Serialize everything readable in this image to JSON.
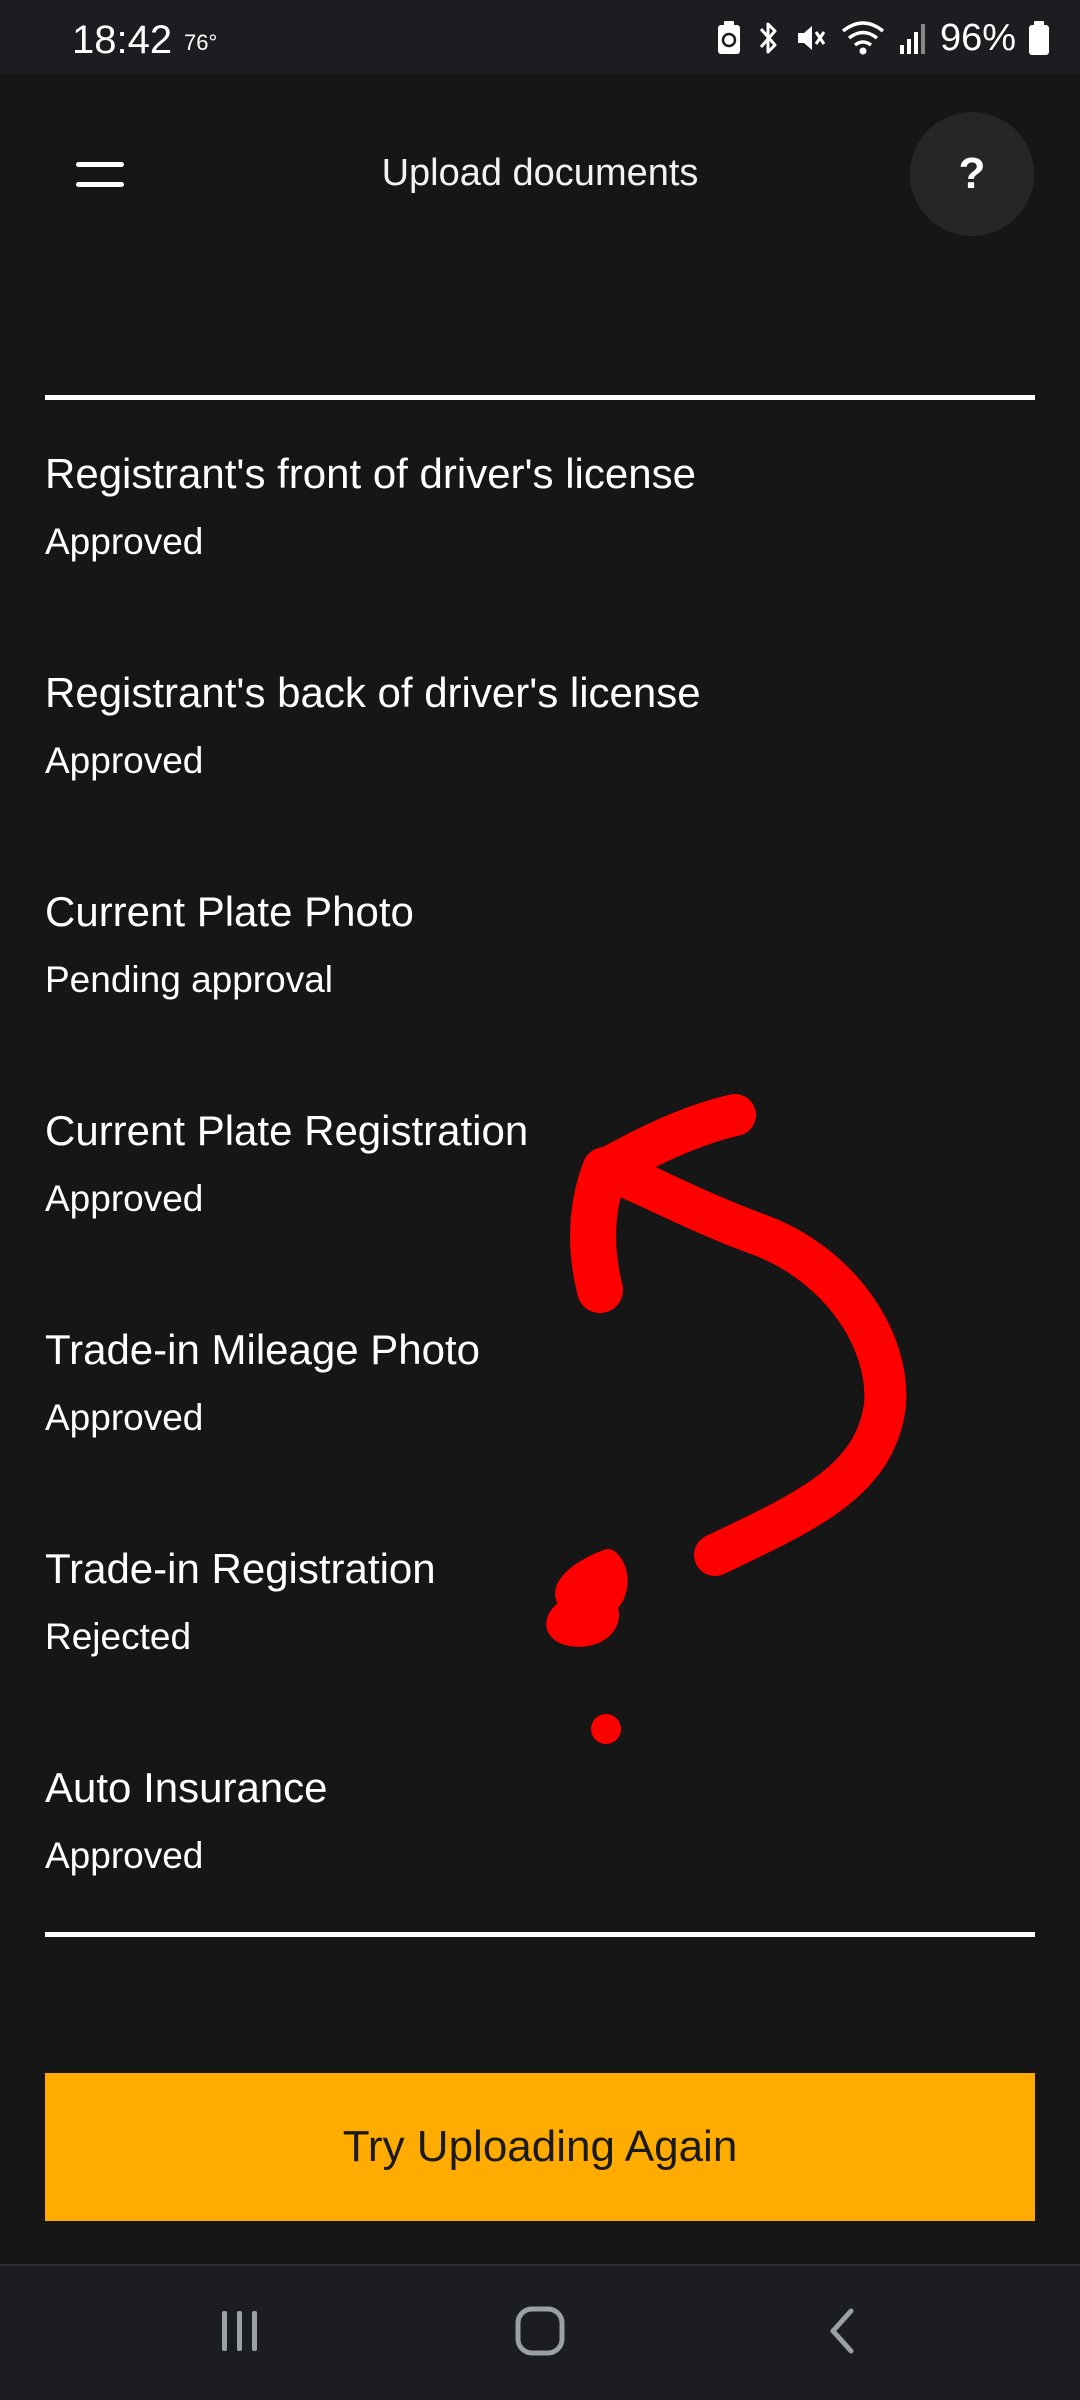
{
  "status_bar": {
    "time": "18:42",
    "temperature": "76°",
    "battery_percent": "96%",
    "icons": [
      "battery-saver-icon",
      "bluetooth-icon",
      "mute-icon",
      "wifi-icon",
      "signal-icon",
      "battery-icon"
    ]
  },
  "app_bar": {
    "title": "Upload documents",
    "menu_icon": "hamburger-menu-icon",
    "help_label": "?"
  },
  "documents": [
    {
      "title": "Registrant's front of driver's license",
      "status": "Approved"
    },
    {
      "title": "Registrant's back of driver's license",
      "status": "Approved"
    },
    {
      "title": "Current Plate Photo",
      "status": "Pending approval"
    },
    {
      "title": "Current Plate Registration",
      "status": "Approved"
    },
    {
      "title": "Trade-in Mileage Photo",
      "status": "Approved"
    },
    {
      "title": "Trade-in Registration",
      "status": "Rejected"
    },
    {
      "title": "Auto Insurance",
      "status": "Approved"
    }
  ],
  "actions": {
    "retry_label": "Try Uploading Again"
  },
  "nav_bar": {
    "icons": [
      "recent-apps-icon",
      "home-icon",
      "back-icon"
    ]
  },
  "colors": {
    "background": "#161616",
    "accent": "#ffab00",
    "annotation": "#ff0000"
  }
}
